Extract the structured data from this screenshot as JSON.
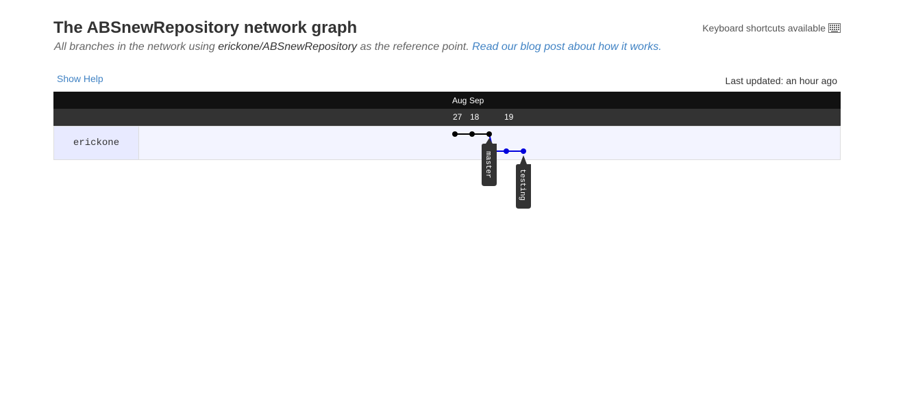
{
  "header": {
    "title": "The ABSnewRepository network graph",
    "subtitle_prefix": "All branches in the network using ",
    "subtitle_ref": "erickone/ABSnewRepository",
    "subtitle_suffix": " as the reference point. ",
    "blog_link": "Read our blog post about how it works."
  },
  "shortcuts": {
    "label": "Keyboard shortcuts available",
    "icon": "keyboard-icon"
  },
  "controls": {
    "show_help": "Show Help",
    "last_updated": "Last updated: an hour ago"
  },
  "graph": {
    "months": [
      "Aug",
      "Sep"
    ],
    "days": [
      "27",
      "18",
      "19"
    ],
    "user": "erickone",
    "branches": [
      {
        "name": "master",
        "color": "#000000"
      },
      {
        "name": "testing",
        "color": "#0000dd"
      }
    ]
  },
  "colors": {
    "link": "#4183c4",
    "month_bar": "#111111",
    "day_bar": "#333333",
    "row_bg": "#f3f4ff",
    "master": "#000000",
    "testing": "#0000dd",
    "tag_bg": "#333333"
  }
}
